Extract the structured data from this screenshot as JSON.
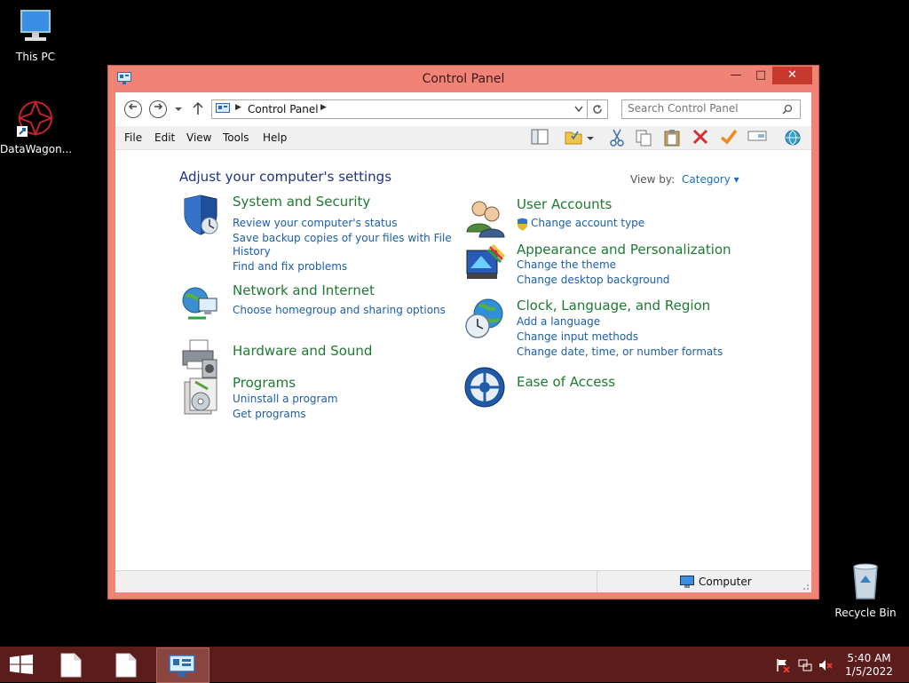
{
  "desktop": {
    "this_pc": "This PC",
    "datawagon": "DataWagon...",
    "recycle_bin": "Recycle Bin"
  },
  "window": {
    "title": "Control Panel",
    "minimize": "—",
    "maximize": "□",
    "close": "✕"
  },
  "nav": {
    "back_icon": "arrow-left",
    "forward_icon": "arrow-right",
    "breadcrumb": "Control Panel",
    "search_placeholder": "Search Control Panel"
  },
  "menu": [
    "File",
    "Edit",
    "View",
    "Tools",
    "Help"
  ],
  "content": {
    "heading": "Adjust your computer's settings",
    "view_by_label": "View by:",
    "view_by_value": "Category ▾",
    "categories_left": [
      {
        "title": "System and Security",
        "links": [
          "Review your computer's status",
          "Save backup copies of your files with File",
          "History",
          "Find and fix problems"
        ]
      },
      {
        "title": "Network and Internet",
        "links": [
          "Choose homegroup and sharing options"
        ]
      },
      {
        "title": "Hardware and Sound",
        "links": []
      },
      {
        "title": "Programs",
        "links": [
          "Uninstall a program",
          "Get programs"
        ]
      }
    ],
    "categories_right": [
      {
        "title": "User Accounts",
        "links": [
          "Change account type"
        ]
      },
      {
        "title": "Appearance and Personalization",
        "links": [
          "Change the theme",
          "Change desktop background"
        ]
      },
      {
        "title": "Clock, Language, and Region",
        "links": [
          "Add a language",
          "Change input methods",
          "Change date, time, or number formats"
        ]
      },
      {
        "title": "Ease of Access",
        "links": []
      }
    ]
  },
  "status": {
    "computer": "Computer"
  },
  "taskbar": {
    "time": "5:40 AM",
    "date": "1/5/2022"
  },
  "colors": {
    "titlebar": "#f18276",
    "close": "#c7392c",
    "taskbar": "#5a1d1b",
    "category_title": "#1e7a32",
    "link": "#1c5ea8",
    "heading": "#1e3287"
  }
}
